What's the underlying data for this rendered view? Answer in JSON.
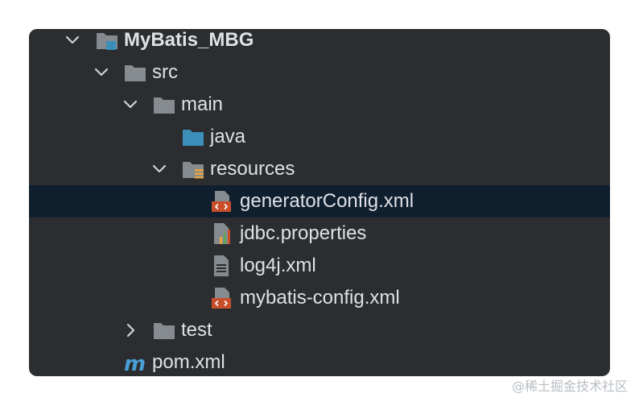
{
  "project_tree": {
    "root": {
      "label": "MyBatis_MBG"
    },
    "src": {
      "label": "src"
    },
    "main": {
      "label": "main"
    },
    "java": {
      "label": "java"
    },
    "resources": {
      "label": "resources"
    },
    "files": [
      {
        "label": "generatorConfig.xml",
        "icon": "xml-file-icon",
        "selected": true
      },
      {
        "label": "jdbc.properties",
        "icon": "properties-file-icon"
      },
      {
        "label": "log4j.xml",
        "icon": "text-file-icon"
      },
      {
        "label": "mybatis-config.xml",
        "icon": "xml-file-icon"
      }
    ],
    "test": {
      "label": "test"
    },
    "pom": {
      "label": "pom.xml"
    }
  },
  "watermark": "@稀土掘金技术社区",
  "colors": {
    "panel_background": "#2b2d30",
    "selection": "#0f1f2e",
    "text": "#dfe1e5",
    "folder": "#868b90",
    "source_folder": "#3b8fb9",
    "xml_accent": "#c94f2b",
    "maven": "#4a9fd4"
  }
}
